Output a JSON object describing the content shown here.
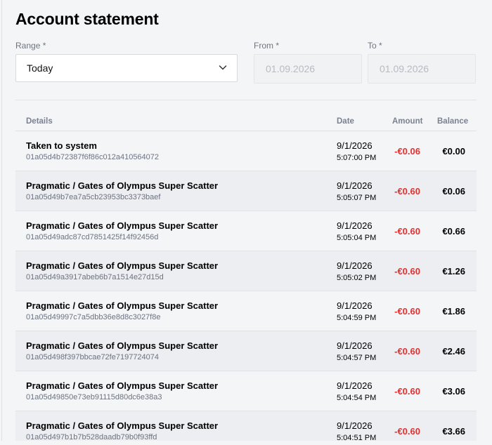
{
  "page": {
    "title": "Account statement"
  },
  "filters": {
    "range_label": "Range *",
    "range_value": "Today",
    "from_label": "From *",
    "from_value": "01.09.2026",
    "to_label": "To *",
    "to_value": "01.09.2026"
  },
  "table": {
    "headers": {
      "details": "Details",
      "date": "Date",
      "amount": "Amount",
      "balance": "Balance"
    },
    "rows": [
      {
        "name": "Taken to system",
        "tx": "01a05d4b72387f6f86c012a410564072",
        "date": "9/1/2026",
        "time": "5:07:00 PM",
        "amount": "-€0.06",
        "balance": "€0.00"
      },
      {
        "name": "Pragmatic / Gates of Olympus Super Scatter",
        "tx": "01a05d49b7ea7a5cb23953bc3373baef",
        "date": "9/1/2026",
        "time": "5:05:07 PM",
        "amount": "-€0.60",
        "balance": "€0.06"
      },
      {
        "name": "Pragmatic / Gates of Olympus Super Scatter",
        "tx": "01a05d49adc87cd7851425f14f92456d",
        "date": "9/1/2026",
        "time": "5:05:04 PM",
        "amount": "-€0.60",
        "balance": "€0.66"
      },
      {
        "name": "Pragmatic / Gates of Olympus Super Scatter",
        "tx": "01a05d49a3917abeb6b7a1514e27d15d",
        "date": "9/1/2026",
        "time": "5:05:02 PM",
        "amount": "-€0.60",
        "balance": "€1.26"
      },
      {
        "name": "Pragmatic / Gates of Olympus Super Scatter",
        "tx": "01a05d49997c7a5dbb36e8d8c3027f8e",
        "date": "9/1/2026",
        "time": "5:04:59 PM",
        "amount": "-€0.60",
        "balance": "€1.86"
      },
      {
        "name": "Pragmatic / Gates of Olympus Super Scatter",
        "tx": "01a05d498f397bbcae72fe7197724074",
        "date": "9/1/2026",
        "time": "5:04:57 PM",
        "amount": "-€0.60",
        "balance": "€2.46"
      },
      {
        "name": "Pragmatic / Gates of Olympus Super Scatter",
        "tx": "01a05d49850e73eb91115d80dc6e38a3",
        "date": "9/1/2026",
        "time": "5:04:54 PM",
        "amount": "-€0.60",
        "balance": "€3.06"
      },
      {
        "name": "Pragmatic / Gates of Olympus Super Scatter",
        "tx": "01a05d497b1b7b528daadb79b0f93ffd",
        "date": "9/1/2026",
        "time": "5:04:51 PM",
        "amount": "-€0.60",
        "balance": "€3.66"
      }
    ]
  },
  "colors": {
    "negative_amount": "#e03131",
    "page_background": "#f4f5f7"
  },
  "icons": {
    "range_dropdown": "chevron-down-icon"
  }
}
